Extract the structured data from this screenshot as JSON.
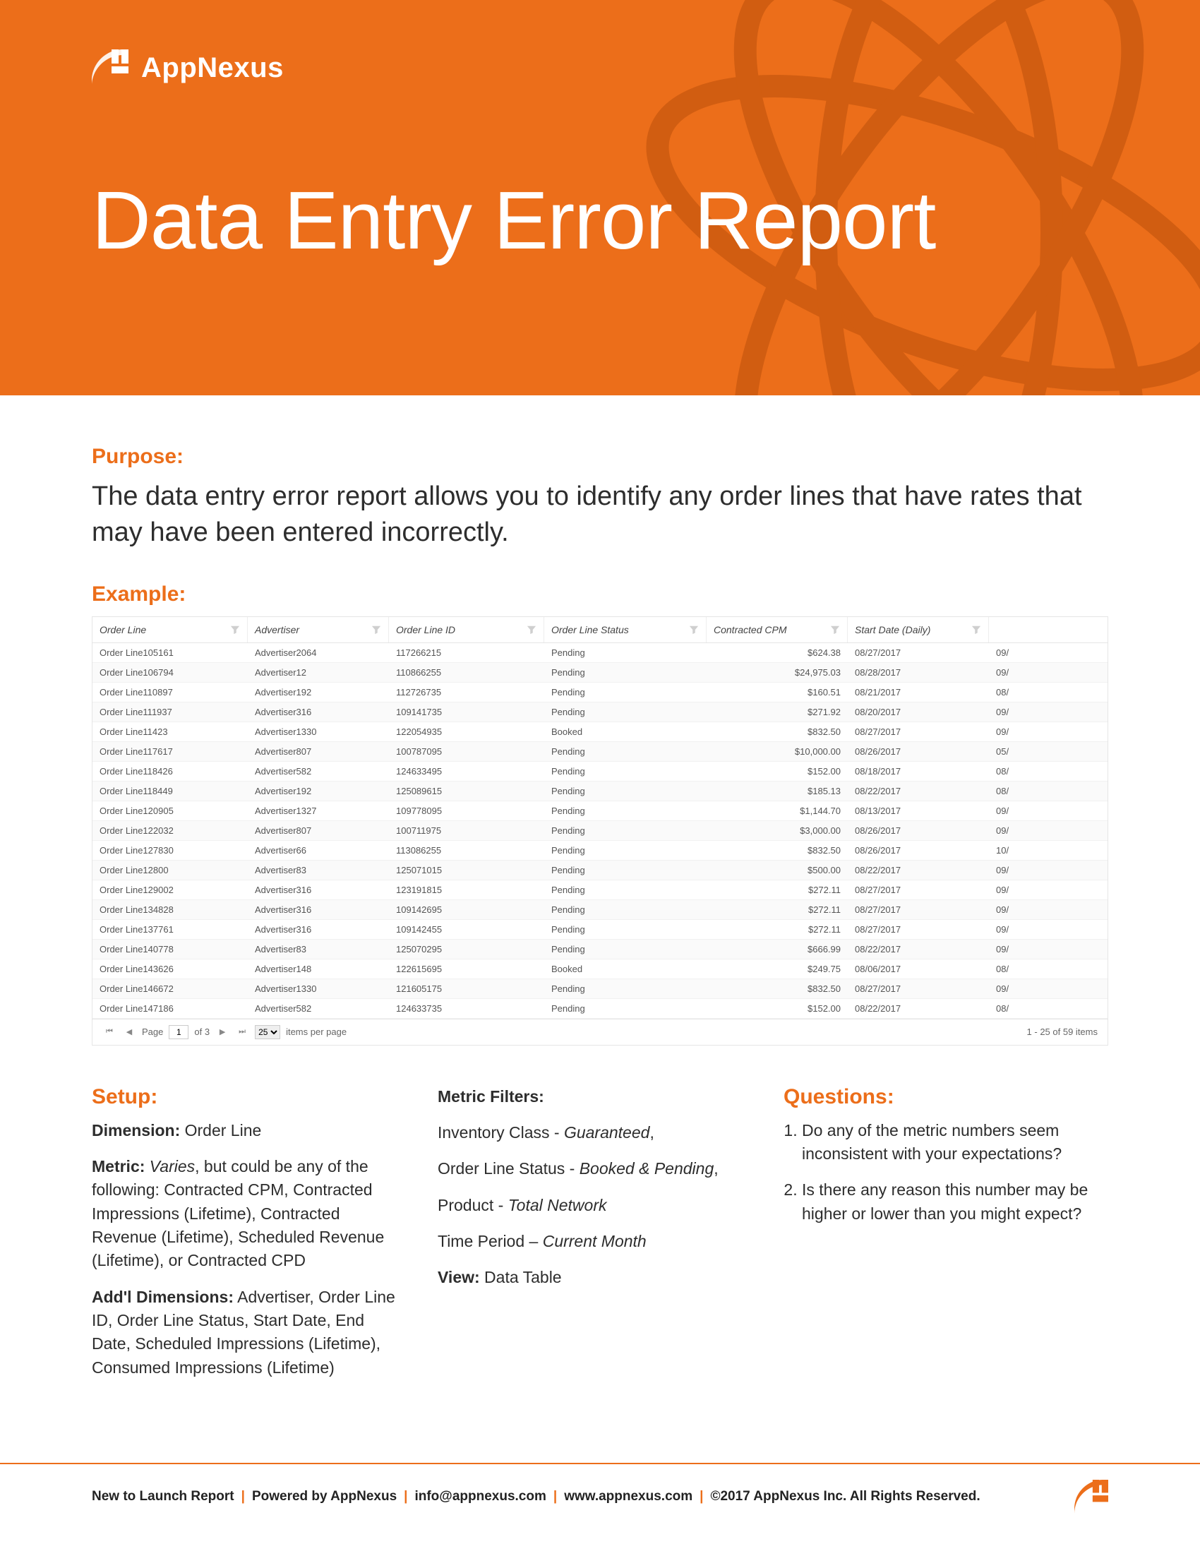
{
  "brand": {
    "name": "AppNexus"
  },
  "hero": {
    "title": "Data Entry Error Report"
  },
  "purpose": {
    "label": "Purpose:",
    "text": "The data entry error report allows you to identify any order lines that have rates that may have been entered incorrectly."
  },
  "example": {
    "label": "Example:",
    "columns": [
      "Order Line",
      "Advertiser",
      "Order Line ID",
      "Order Line Status",
      "Contracted CPM",
      "Start Date  (Daily)",
      ""
    ],
    "rows": [
      [
        "Order Line105161",
        "Advertiser2064",
        "117266215",
        "Pending",
        "$624.38",
        "08/27/2017",
        "09/"
      ],
      [
        "Order Line106794",
        "Advertiser12",
        "110866255",
        "Pending",
        "$24,975.03",
        "08/28/2017",
        "09/"
      ],
      [
        "Order Line110897",
        "Advertiser192",
        "112726735",
        "Pending",
        "$160.51",
        "08/21/2017",
        "08/"
      ],
      [
        "Order Line111937",
        "Advertiser316",
        "109141735",
        "Pending",
        "$271.92",
        "08/20/2017",
        "09/"
      ],
      [
        "Order Line11423",
        "Advertiser1330",
        "122054935",
        "Booked",
        "$832.50",
        "08/27/2017",
        "09/"
      ],
      [
        "Order Line117617",
        "Advertiser807",
        "100787095",
        "Pending",
        "$10,000.00",
        "08/26/2017",
        "05/"
      ],
      [
        "Order Line118426",
        "Advertiser582",
        "124633495",
        "Pending",
        "$152.00",
        "08/18/2017",
        "08/"
      ],
      [
        "Order Line118449",
        "Advertiser192",
        "125089615",
        "Pending",
        "$185.13",
        "08/22/2017",
        "08/"
      ],
      [
        "Order Line120905",
        "Advertiser1327",
        "109778095",
        "Pending",
        "$1,144.70",
        "08/13/2017",
        "09/"
      ],
      [
        "Order Line122032",
        "Advertiser807",
        "100711975",
        "Pending",
        "$3,000.00",
        "08/26/2017",
        "09/"
      ],
      [
        "Order Line127830",
        "Advertiser66",
        "113086255",
        "Pending",
        "$832.50",
        "08/26/2017",
        "10/"
      ],
      [
        "Order Line12800",
        "Advertiser83",
        "125071015",
        "Pending",
        "$500.00",
        "08/22/2017",
        "09/"
      ],
      [
        "Order Line129002",
        "Advertiser316",
        "123191815",
        "Pending",
        "$272.11",
        "08/27/2017",
        "09/"
      ],
      [
        "Order Line134828",
        "Advertiser316",
        "109142695",
        "Pending",
        "$272.11",
        "08/27/2017",
        "09/"
      ],
      [
        "Order Line137761",
        "Advertiser316",
        "109142455",
        "Pending",
        "$272.11",
        "08/27/2017",
        "09/"
      ],
      [
        "Order Line140778",
        "Advertiser83",
        "125070295",
        "Pending",
        "$666.99",
        "08/22/2017",
        "09/"
      ],
      [
        "Order Line143626",
        "Advertiser148",
        "122615695",
        "Booked",
        "$249.75",
        "08/06/2017",
        "08/"
      ],
      [
        "Order Line146672",
        "Advertiser1330",
        "121605175",
        "Pending",
        "$832.50",
        "08/27/2017",
        "09/"
      ],
      [
        "Order Line147186",
        "Advertiser582",
        "124633735",
        "Pending",
        "$152.00",
        "08/22/2017",
        "08/"
      ]
    ],
    "pager": {
      "page_label": "Page",
      "page_current": "1",
      "page_of": "of 3",
      "per_page": "25",
      "per_page_label": "items per page",
      "range": "1 - 25 of 59 items"
    }
  },
  "setup": {
    "label": "Setup:",
    "dimension_label": "Dimension:",
    "dimension_value": "Order Line",
    "metric_label": "Metric:",
    "metric_varies": "Varies",
    "metric_text": ", but could be any of the following: Contracted CPM, Contracted Impressions (Lifetime), Contracted Revenue (Lifetime), Scheduled Revenue (Lifetime), or Contracted CPD",
    "addl_label": "Add'l Dimensions:",
    "addl_value": "Advertiser, Order Line ID, Order Line Status, Start Date, End Date, Scheduled Impressions (Lifetime), Consumed Impressions (Lifetime)"
  },
  "filters": {
    "label": "Metric Filters:",
    "inventory_label": "Inventory Class - ",
    "inventory_value": "Guaranteed",
    "status_label": "Order Line Status - ",
    "status_value": "Booked & Pending",
    "product_label": "Product - ",
    "product_value": "Total Network",
    "time_label": "Time Period – ",
    "time_value": "Current Month",
    "view_label": "View:",
    "view_value": "Data Table"
  },
  "questions": {
    "label": "Questions:",
    "items": [
      "Do any of the metric numbers seem inconsistent with your expectations?",
      "Is there any reason this number may be higher or lower than you might expect?"
    ]
  },
  "footer": {
    "parts": [
      "New to Launch Report",
      "Powered by AppNexus",
      "info@appnexus.com",
      "www.appnexus.com",
      "©2017 AppNexus Inc. All Rights Reserved."
    ]
  }
}
